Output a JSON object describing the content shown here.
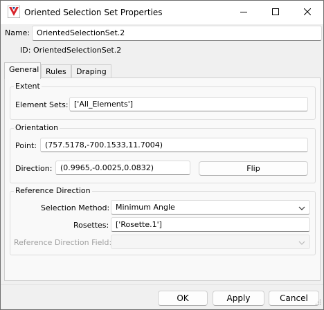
{
  "window": {
    "title": "Oriented Selection Set Properties",
    "app_icon": "app-logo-icon",
    "controls": [
      "minimize-icon",
      "maximize-icon",
      "close-icon"
    ]
  },
  "header": {
    "name_label": "Name:",
    "name_value": "OrientedSelectionSet.2",
    "id_label": "ID:",
    "id_value": "OrientedSelectionSet.2"
  },
  "tabs": [
    {
      "label": "General",
      "active": true
    },
    {
      "label": "Rules",
      "active": false
    },
    {
      "label": "Draping",
      "active": false
    }
  ],
  "extent": {
    "title": "Extent",
    "element_sets_label": "Element Sets:",
    "element_sets_value": "['All_Elements']"
  },
  "orientation": {
    "title": "Orientation",
    "point_label": "Point:",
    "point_value": "(757.5178,-700.1533,11.7004)",
    "direction_label": "Direction:",
    "direction_value": "(0.9965,-0.0025,0.0832)",
    "flip_label": "Flip"
  },
  "reference_direction": {
    "title": "Reference Direction",
    "selection_method_label": "Selection Method:",
    "selection_method_value": "Minimum Angle",
    "rosettes_label": "Rosettes:",
    "rosettes_value": "['Rosette.1']",
    "ref_field_label": "Reference Direction Field:",
    "ref_field_value": ""
  },
  "footer": {
    "ok_label": "OK",
    "apply_label": "Apply",
    "cancel_label": "Cancel"
  },
  "colors": {
    "accent": "#0078d4",
    "window_bg": "#f0f0f0",
    "panel_bg": "#f9f9f9",
    "disabled_text": "#a0a0a0"
  }
}
